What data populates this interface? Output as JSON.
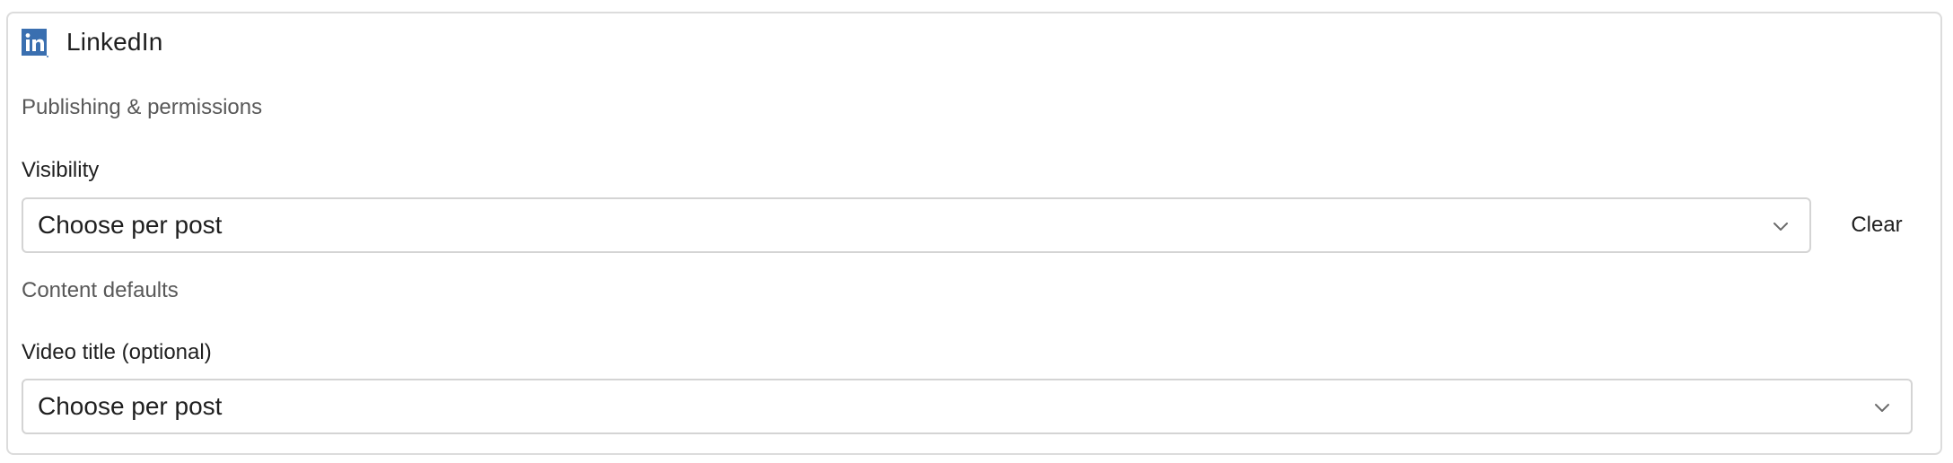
{
  "integration": {
    "name": "LinkedIn",
    "icon": "linkedin-logo-icon",
    "brand_color": "#3a6fb0"
  },
  "sections": {
    "publishing_label": "Publishing & permissions",
    "content_label": "Content defaults"
  },
  "visibility": {
    "label": "Visibility",
    "value": "Choose per post",
    "clear_label": "Clear"
  },
  "video_title": {
    "label": "Video title (optional)",
    "value": "Choose per post"
  }
}
